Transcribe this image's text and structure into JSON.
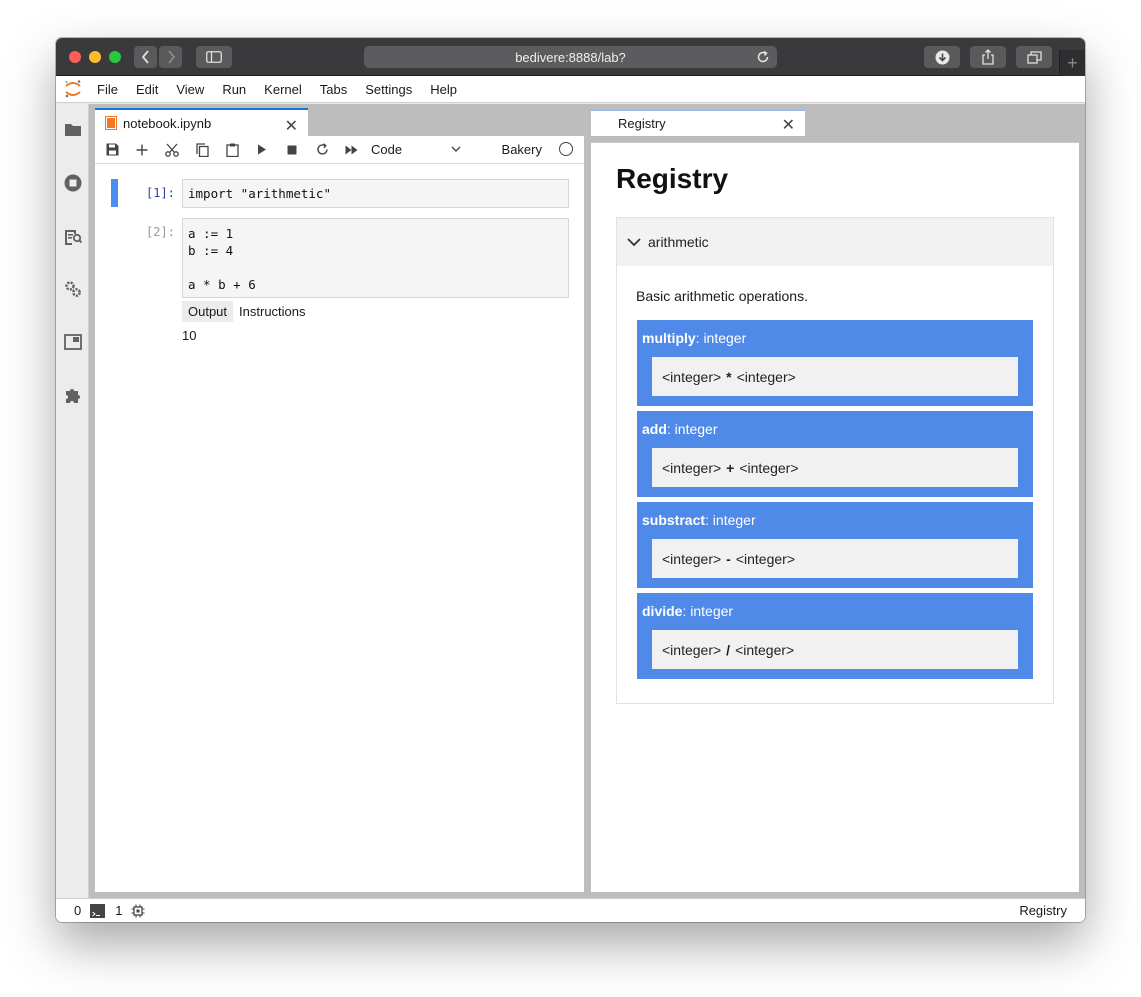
{
  "browser": {
    "url": "bedivere:8888/lab?"
  },
  "menu": [
    "File",
    "Edit",
    "View",
    "Run",
    "Kernel",
    "Tabs",
    "Settings",
    "Help"
  ],
  "notebook": {
    "tab_label": "notebook.ipynb",
    "cell_type": "Code",
    "kernel_name": "Bakery",
    "cells": [
      {
        "prompt": "[1]:",
        "source": "import \"arithmetic\""
      },
      {
        "prompt": "[2]:",
        "source": "a := 1\nb := 4\n\na * b + 6"
      }
    ],
    "output_tabs": [
      "Output",
      "Instructions"
    ],
    "output_value": "10"
  },
  "registry": {
    "tab_label": "Registry",
    "title": "Registry",
    "section": {
      "name": "arithmetic",
      "description": "Basic arithmetic operations.",
      "operations": [
        {
          "name": "multiply",
          "type": ": integer",
          "left": "<integer>",
          "op": "*",
          "right": "<integer>"
        },
        {
          "name": "add",
          "type": ": integer",
          "left": "<integer>",
          "op": "+",
          "right": "<integer>"
        },
        {
          "name": "substract",
          "type": ": integer",
          "left": "<integer>",
          "op": "-",
          "right": "<integer>"
        },
        {
          "name": "divide",
          "type": ": integer",
          "left": "<integer>",
          "op": "/",
          "right": "<integer>"
        }
      ]
    }
  },
  "statusbar": {
    "terminals": "0",
    "kernels": "1",
    "right_label": "Registry"
  },
  "colors": {
    "accent": "#4f8ae8",
    "cell_active": "#4a8ef0",
    "prompt_in": "#303f9f"
  }
}
